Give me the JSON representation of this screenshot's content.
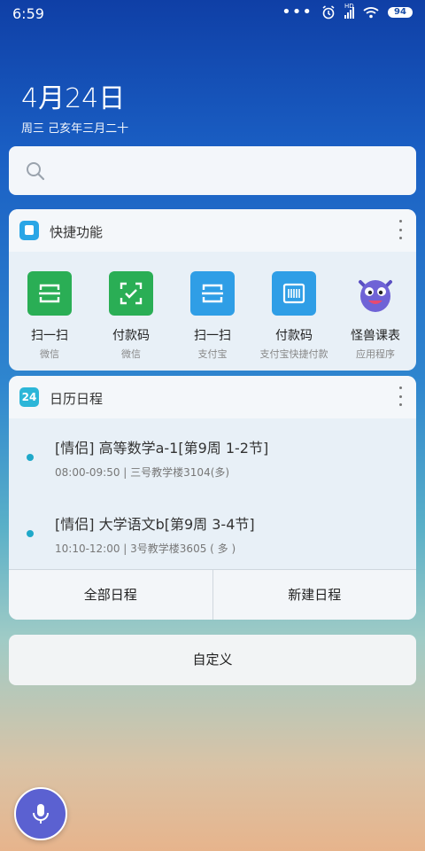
{
  "status_bar": {
    "time": "6:59",
    "battery": "94",
    "network": "HD"
  },
  "date": {
    "main": "4月24日",
    "sub": "周三 己亥年三月二十"
  },
  "search": {
    "placeholder": ""
  },
  "quick_functions": {
    "title": "快捷功能",
    "items": [
      {
        "label": "扫一扫",
        "sub": "微信",
        "color": "#2aae55",
        "icon": "scan-icon"
      },
      {
        "label": "付款码",
        "sub": "微信",
        "color": "#2aae55",
        "icon": "pay-code-icon"
      },
      {
        "label": "扫一扫",
        "sub": "支付宝",
        "color": "#2f9ee6",
        "icon": "scan-icon"
      },
      {
        "label": "付款码",
        "sub": "支付宝快捷付款",
        "color": "#2f9ee6",
        "icon": "barcode-icon"
      },
      {
        "label": "怪兽课表",
        "sub": "应用程序",
        "color": "#6f63d6",
        "icon": "monster-icon"
      }
    ]
  },
  "calendar": {
    "badge": "24",
    "title": "日历日程",
    "events": [
      {
        "title": "[情侣] 高等数学a-1[第9周 1-2节]",
        "info": "08:00-09:50 | 三号教学楼3104(多)"
      },
      {
        "title": "[情侣] 大学语文b[第9周 3-4节]",
        "info": "10:10-12:00 | 3号教学楼3605 ( 多 )"
      }
    ],
    "buttons": {
      "all": "全部日程",
      "new": "新建日程"
    }
  },
  "customize": {
    "label": "自定义"
  },
  "colors": {
    "accent": "#2cb6d8",
    "mic": "#5b61d1"
  }
}
